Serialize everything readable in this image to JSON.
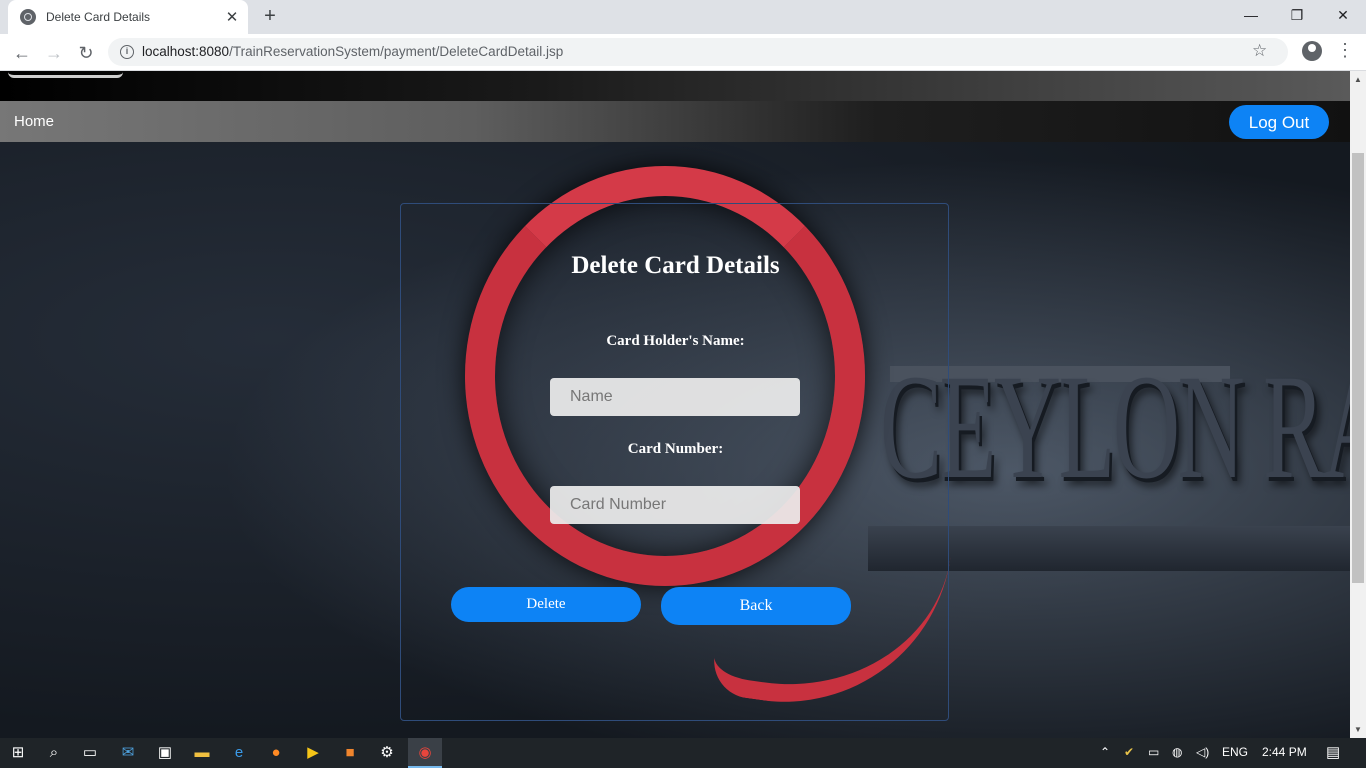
{
  "browser": {
    "tab_title": "Delete Card Details",
    "tab_close": "✕",
    "new_tab": "+",
    "url_host": "localhost:8080",
    "url_path": "/TrainReservationSystem/payment/DeleteCardDetail.jsp",
    "win_minimize": "—",
    "win_restore": "❐",
    "win_close": "✕"
  },
  "nav": {
    "home_label": "Home",
    "logout_label": "Log Out"
  },
  "background": {
    "brand_text": "CEYLON RA"
  },
  "form": {
    "title": "Delete Card Details",
    "holder_label": "Card Holder's Name:",
    "holder_placeholder": "Name",
    "number_label": "Card Number:",
    "number_placeholder": "Card Number",
    "delete_label": "Delete",
    "back_label": "Back"
  },
  "taskbar": {
    "language": "ENG",
    "time": "2:44 PM"
  },
  "colors": {
    "accent": "#0d83f5",
    "logo_red": "#c8313f"
  }
}
